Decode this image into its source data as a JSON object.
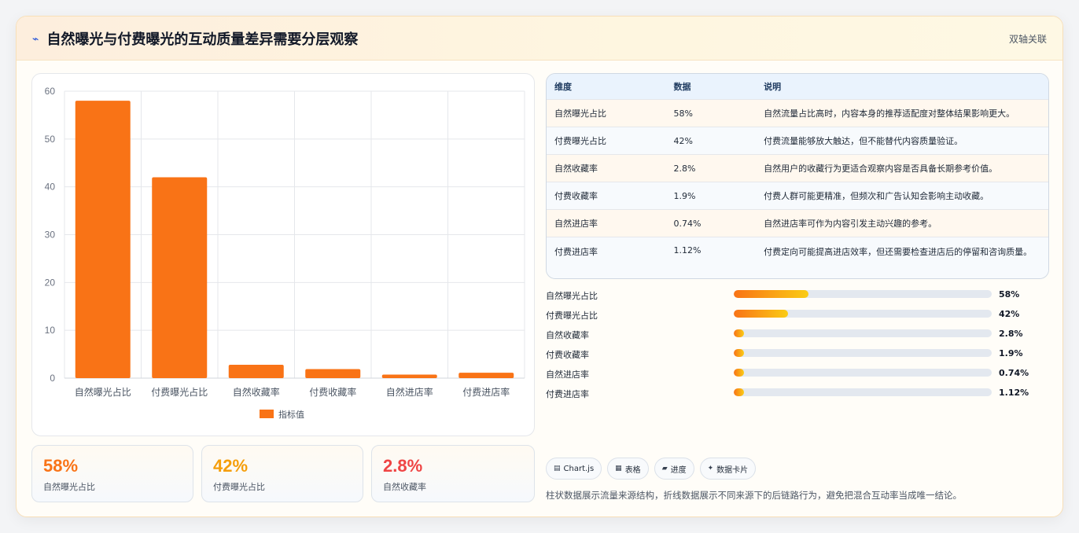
{
  "header": {
    "icon": "lightning-icon",
    "title": "自然曝光与付费曝光的互动质量差异需要分层观察",
    "tag": "双轴关联"
  },
  "chart_data": {
    "type": "bar",
    "categories": [
      "自然曝光占比",
      "付费曝光占比",
      "自然收藏率",
      "付费收藏率",
      "自然进店率",
      "付费进店率"
    ],
    "series": [
      {
        "name": "指标值",
        "values": [
          58,
          42,
          2.8,
          1.9,
          0.74,
          1.12
        ]
      }
    ],
    "ylim": [
      0,
      60
    ],
    "yticks": [
      0,
      10,
      20,
      30,
      40,
      50,
      60
    ],
    "grid": true,
    "legend": "bottom",
    "color": "#f97316"
  },
  "stats": [
    {
      "value": "58%",
      "label": "自然曝光占比",
      "color": "#f97316"
    },
    {
      "value": "42%",
      "label": "付费曝光占比",
      "color": "#f59e0b"
    },
    {
      "value": "2.8%",
      "label": "自然收藏率",
      "color": "#ef4444"
    }
  ],
  "table": {
    "headers": [
      "维度",
      "数据",
      "说明"
    ],
    "rows": [
      {
        "dim": "自然曝光占比",
        "val": "58%",
        "desc": "自然流量占比高时，内容本身的推荐适配度对整体结果影响更大。"
      },
      {
        "dim": "付费曝光占比",
        "val": "42%",
        "desc": "付费流量能够放大触达，但不能替代内容质量验证。"
      },
      {
        "dim": "自然收藏率",
        "val": "2.8%",
        "desc": "自然用户的收藏行为更适合观察内容是否具备长期参考价值。"
      },
      {
        "dim": "付费收藏率",
        "val": "1.9%",
        "desc": "付费人群可能更精准，但频次和广告认知会影响主动收藏。"
      },
      {
        "dim": "自然进店率",
        "val": "0.74%",
        "desc": "自然进店率可作为内容引发主动兴趣的参考。"
      },
      {
        "dim": "付费进店率",
        "val": "1.12%",
        "desc": "付费定向可能提高进店效率，但还需要检查进店后的停留和咨询质量。"
      }
    ]
  },
  "progress": [
    {
      "label": "自然曝光占比",
      "value": "58%",
      "fill_percent": 29
    },
    {
      "label": "付费曝光占比",
      "value": "42%",
      "fill_percent": 21
    },
    {
      "label": "自然收藏率",
      "value": "2.8%",
      "fill_percent": 4
    },
    {
      "label": "付费收藏率",
      "value": "1.9%",
      "fill_percent": 4
    },
    {
      "label": "自然进店率",
      "value": "0.74%",
      "fill_percent": 4
    },
    {
      "label": "付费进店率",
      "value": "1.12%",
      "fill_percent": 4
    }
  ],
  "chips": [
    {
      "icon": "chart-icon",
      "glyph": "▤",
      "label": "Chart.js"
    },
    {
      "icon": "table-icon",
      "glyph": "▦",
      "label": "表格"
    },
    {
      "icon": "progress-icon",
      "glyph": "▰",
      "label": "进度"
    },
    {
      "icon": "sparkle-icon",
      "glyph": "✦",
      "label": "数据卡片"
    }
  ],
  "note": "柱状数据展示流量来源结构，折线数据展示不同来源下的后链路行为，避免把混合互动率当成唯一结论。"
}
